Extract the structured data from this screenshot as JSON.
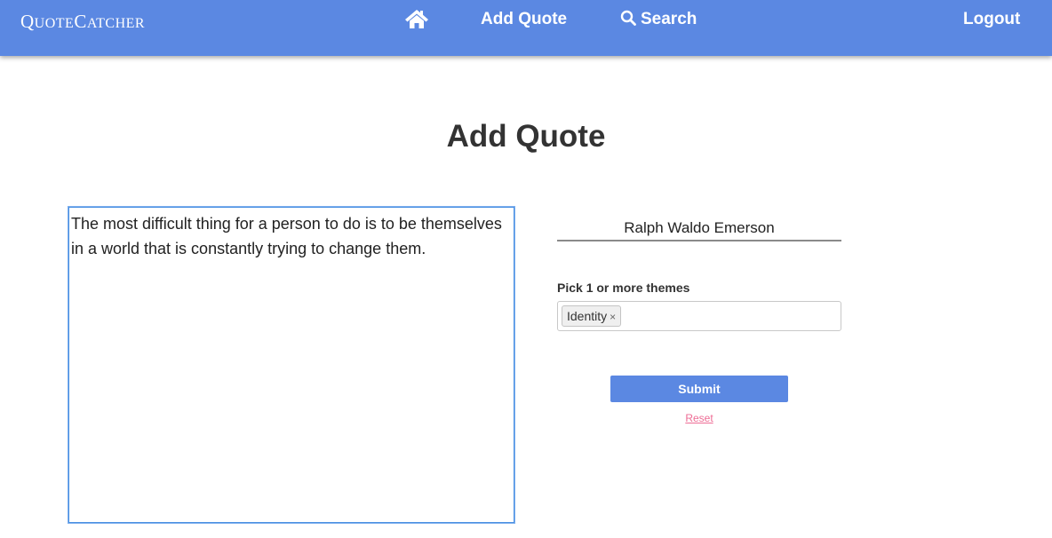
{
  "navbar": {
    "brand_first": "Q",
    "brand_rest_1": "UOTE",
    "brand_mid": "C",
    "brand_rest_2": "ATCHER",
    "home_icon": "home-icon",
    "add_quote_label": "Add Quote",
    "search_icon": "search-icon",
    "search_label": "Search",
    "logout_label": "Logout",
    "color": "#5b88e2"
  },
  "main": {
    "title": "Add Quote",
    "quote_text": "The most difficult thing for a person to do is to be themselves in a world that is constantly trying to change them.",
    "author_value": "Ralph Waldo Emerson",
    "themes_label": "Pick 1 or more themes",
    "selected_themes": [
      "Identity"
    ],
    "tag_remove_glyph": "×",
    "submit_label": "Submit",
    "reset_label": "Reset",
    "reset_color": "#ee6c95"
  }
}
